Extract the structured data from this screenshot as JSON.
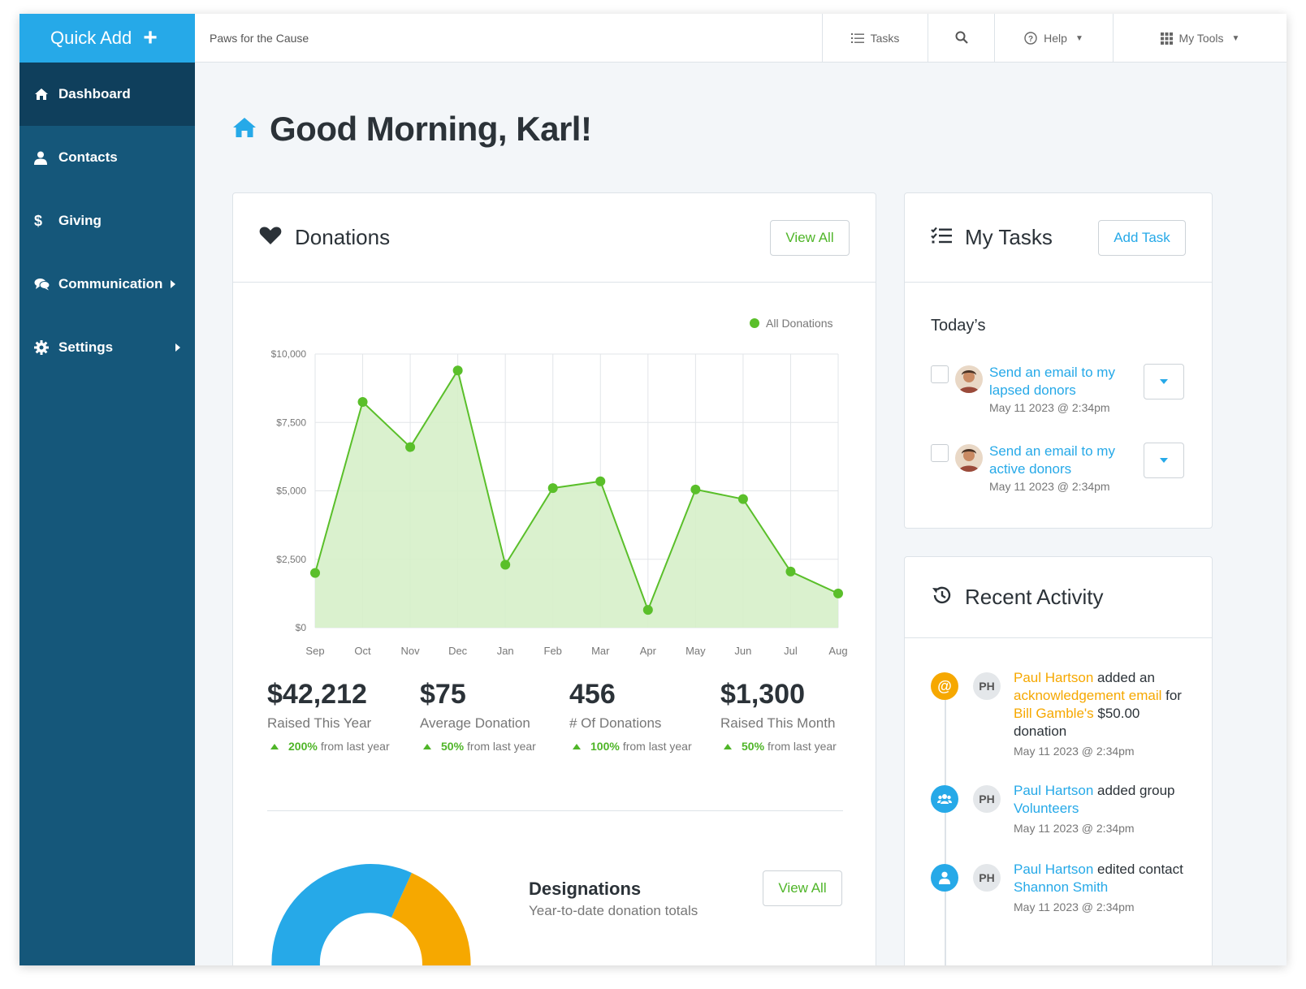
{
  "topbar": {
    "quick_add_label": "Quick Add",
    "org_name": "Paws for the Cause",
    "tasks_label": "Tasks",
    "help_label": "Help",
    "my_tools_label": "My Tools"
  },
  "sidebar": {
    "items": [
      {
        "label": "Dashboard",
        "icon": "home-icon",
        "active": true
      },
      {
        "label": "Contacts",
        "icon": "user-icon"
      },
      {
        "label": "Giving",
        "icon": "dollar-icon"
      },
      {
        "label": "Communication",
        "icon": "comments-icon",
        "submenu": true
      },
      {
        "label": "Settings",
        "icon": "gear-icon",
        "submenu": true
      }
    ]
  },
  "greeting": "Good Morning, Karl!",
  "donations": {
    "title": "Donations",
    "view_all_label": "View All",
    "stats": [
      {
        "value": "$42,212",
        "label": "Raised This Year",
        "pct": "200%",
        "suffix": "from last year"
      },
      {
        "value": "$75",
        "label": "Average Donation",
        "pct": "50%",
        "suffix": "from last year"
      },
      {
        "value": "456",
        "label": "# Of Donations",
        "pct": "100%",
        "suffix": "from last year"
      },
      {
        "value": "$1,300",
        "label": "Raised This Month",
        "pct": "50%",
        "suffix": "from last year"
      }
    ]
  },
  "chart_data": {
    "type": "area",
    "categories": [
      "Sep",
      "Oct",
      "Nov",
      "Dec",
      "Jan",
      "Feb",
      "Mar",
      "Apr",
      "May",
      "Jun",
      "Jul",
      "Aug"
    ],
    "series": [
      {
        "name": "All Donations",
        "values": [
          2000,
          8250,
          6600,
          9400,
          2300,
          5100,
          5350,
          650,
          5050,
          4700,
          2050,
          1250
        ]
      }
    ],
    "yticks": [
      "$10,000",
      "$7,500",
      "$5,000",
      "$2,500",
      "$0"
    ],
    "ylim": [
      0,
      10000
    ],
    "grid": true,
    "legend": "top-right",
    "colors": {
      "line": "#5abf2a",
      "fill": "#d6efc9"
    }
  },
  "designations": {
    "title": "Designations",
    "subtitle": "Year-to-date donation totals",
    "view_all_label": "View All",
    "colors": [
      "#26a9e8",
      "#f6a800"
    ]
  },
  "tasks": {
    "title": "My Tasks",
    "add_label": "Add Task",
    "section": "Today’s",
    "items": [
      {
        "line1": "Send an email to my",
        "line2": "lapsed donors",
        "time": "May 11 2023 @ 2:34pm"
      },
      {
        "line1": "Send an email to my",
        "line2": "active donors",
        "time": "May 11 2023 @ 2:34pm"
      }
    ]
  },
  "activity": {
    "title": "Recent Activity",
    "initials": "PH",
    "items": [
      {
        "actor": "Paul Hartson",
        "verb": " added an ",
        "target": "acknowledgement email",
        "rest1": " for ",
        "target2": "Bill Gamble's",
        "rest2": " $50.00 donation",
        "time": "May 11 2023 @ 2:34pm",
        "icon_color": "#f6a800"
      },
      {
        "actor": "Paul Hartson",
        "verb": " added group ",
        "target": "Volunteers",
        "time": "May 11 2023 @ 2:34pm",
        "icon_color": "#26a9e8"
      },
      {
        "actor": "Paul Hartson",
        "verb": " edited contact ",
        "target": "Shannon Smith",
        "time": "May 11 2023 @ 2:34pm",
        "icon_color": "#26a9e8"
      }
    ]
  }
}
